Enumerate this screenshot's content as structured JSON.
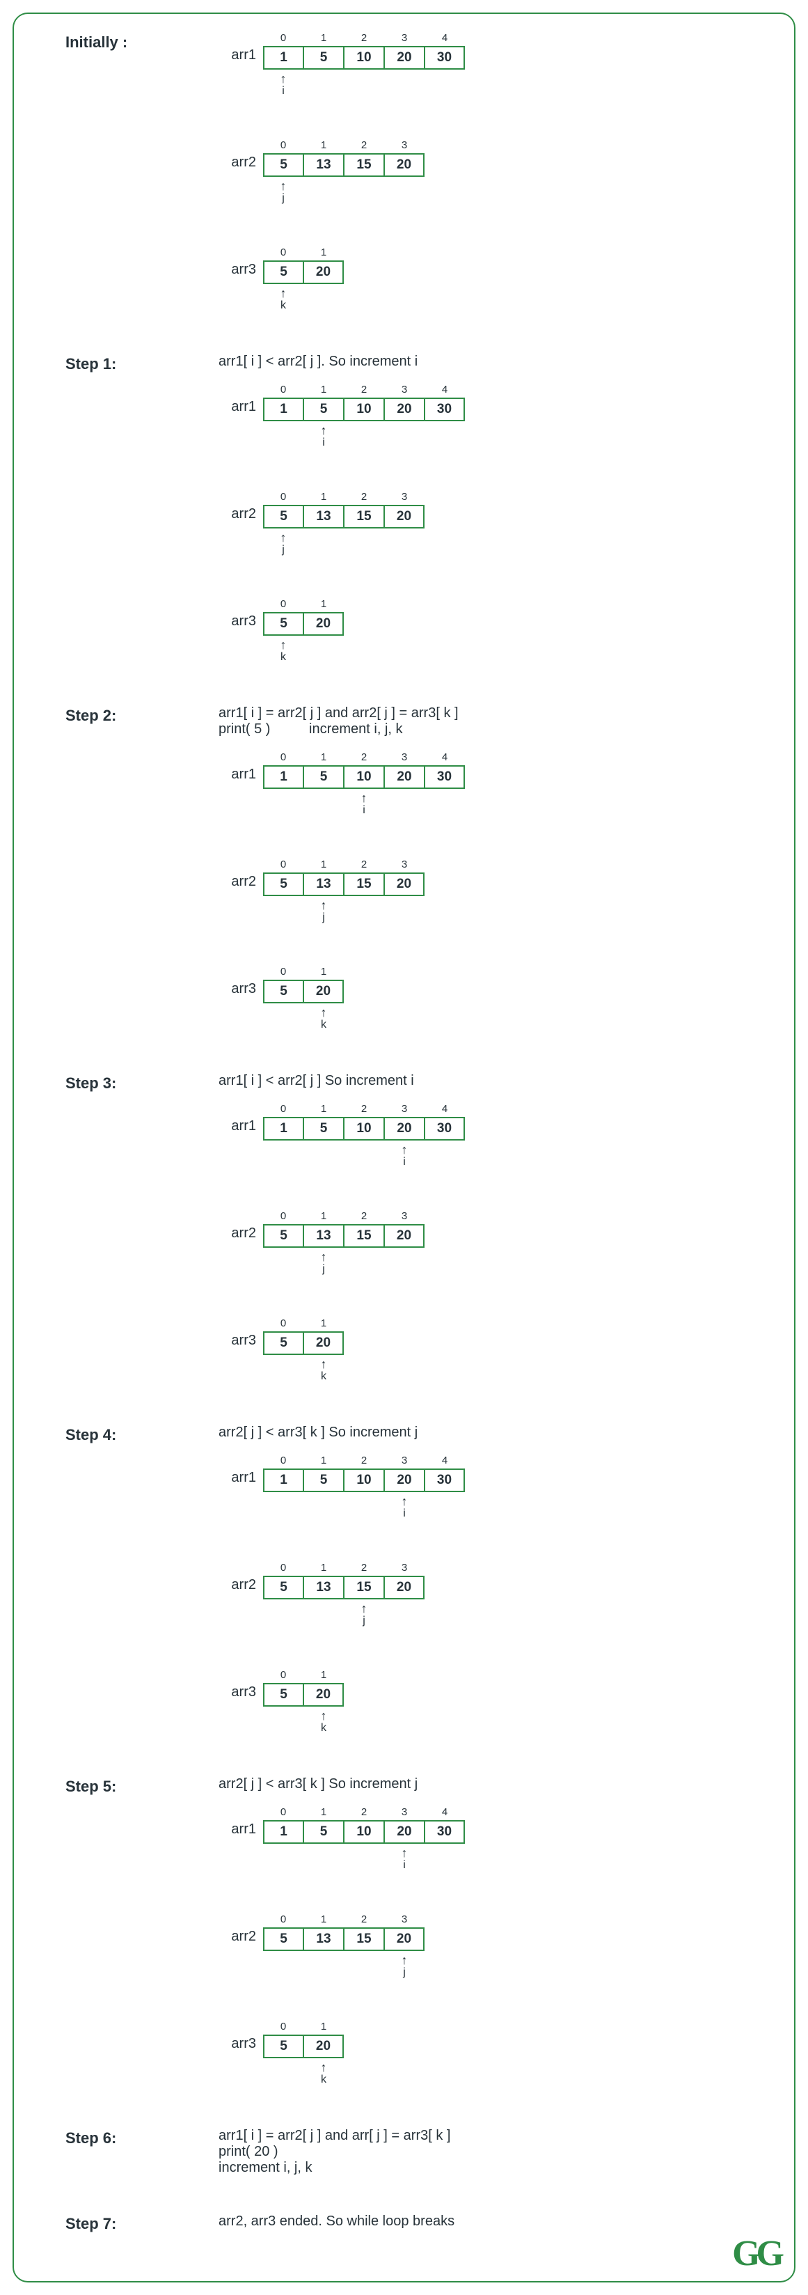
{
  "logo": "GG",
  "pointer_labels": {
    "a1": "i",
    "a2": "j",
    "a3": "k"
  },
  "arr_names": {
    "a1": "arr1",
    "a2": "arr2",
    "a3": "arr3"
  },
  "arr_values": {
    "a1": [
      "1",
      "5",
      "10",
      "20",
      "30"
    ],
    "a2": [
      "5",
      "13",
      "15",
      "20"
    ],
    "a3": [
      "5",
      "20"
    ]
  },
  "steps": [
    {
      "label": "Initially :",
      "show_arrays": true,
      "caption": null,
      "p": {
        "a1": 0,
        "a2": 0,
        "a3": 0
      }
    },
    {
      "label": "Step 1:",
      "show_arrays": true,
      "caption": "arr1[ i ] < arr2[ j ]. So increment i",
      "p": {
        "a1": 1,
        "a2": 0,
        "a3": 0
      }
    },
    {
      "label": "Step 2:",
      "show_arrays": true,
      "caption": "arr1[ i ] = arr2[ j ] and arr2[ j ] = arr3[ k ]\nprint( 5 )          increment i, j, k",
      "p": {
        "a1": 2,
        "a2": 1,
        "a3": 1
      }
    },
    {
      "label": "Step 3:",
      "show_arrays": true,
      "caption": "arr1[ i ] < arr2[ j ] So increment i",
      "p": {
        "a1": 3,
        "a2": 1,
        "a3": 1
      }
    },
    {
      "label": "Step 4:",
      "show_arrays": true,
      "caption": "arr2[ j ] < arr3[ k ] So increment j",
      "p": {
        "a1": 3,
        "a2": 2,
        "a3": 1
      }
    },
    {
      "label": "Step 5:",
      "show_arrays": true,
      "caption": "arr2[ j ] < arr3[ k ] So increment j",
      "p": {
        "a1": 3,
        "a2": 3,
        "a3": 1
      }
    },
    {
      "label": "Step 6:",
      "show_arrays": false,
      "caption": "arr1[ i ] = arr2[ j ] and arr[ j ] = arr3[ k ]\nprint( 20 )\nincrement i, j, k",
      "p": null
    },
    {
      "label": "Step 7:",
      "show_arrays": false,
      "caption": "arr2, arr3 ended. So while loop breaks",
      "p": null
    }
  ]
}
